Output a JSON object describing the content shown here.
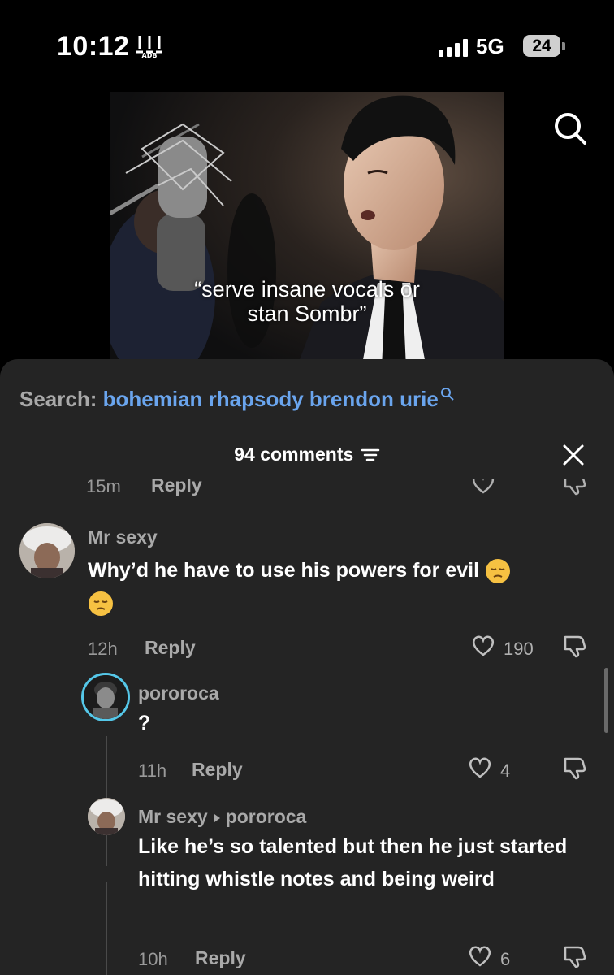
{
  "status": {
    "time": "10:12",
    "network": "5G",
    "battery": "24"
  },
  "video": {
    "caption_line1": "“serve insane vocals or",
    "caption_line2": "stan Sombr”"
  },
  "search": {
    "label": "Search:",
    "query": "bohemian rhapsody brendon urie"
  },
  "comments_header": {
    "count": "94 comments"
  },
  "partial_row": {
    "time": "15m",
    "reply": "Reply"
  },
  "comments": [
    {
      "name": "Mr sexy",
      "text": "Why’d he have to use his powers for evil",
      "time": "12h",
      "reply": "Reply",
      "likes": "190"
    },
    {
      "name": "pororoca",
      "text": "?",
      "time": "11h",
      "reply": "Reply",
      "likes": "4"
    },
    {
      "name": "Mr sexy",
      "reply_to": "pororoca",
      "text": "Like he’s so talented but then he just started hitting whistle notes and being weird",
      "time": "10h",
      "reply": "Reply",
      "likes": "6"
    }
  ],
  "icons": {
    "emoji": "pensive-face-emoji",
    "like": "heart-icon",
    "dislike": "thumbs-down-icon",
    "search": "search-icon",
    "close": "close-icon",
    "filter": "filter-icon"
  }
}
